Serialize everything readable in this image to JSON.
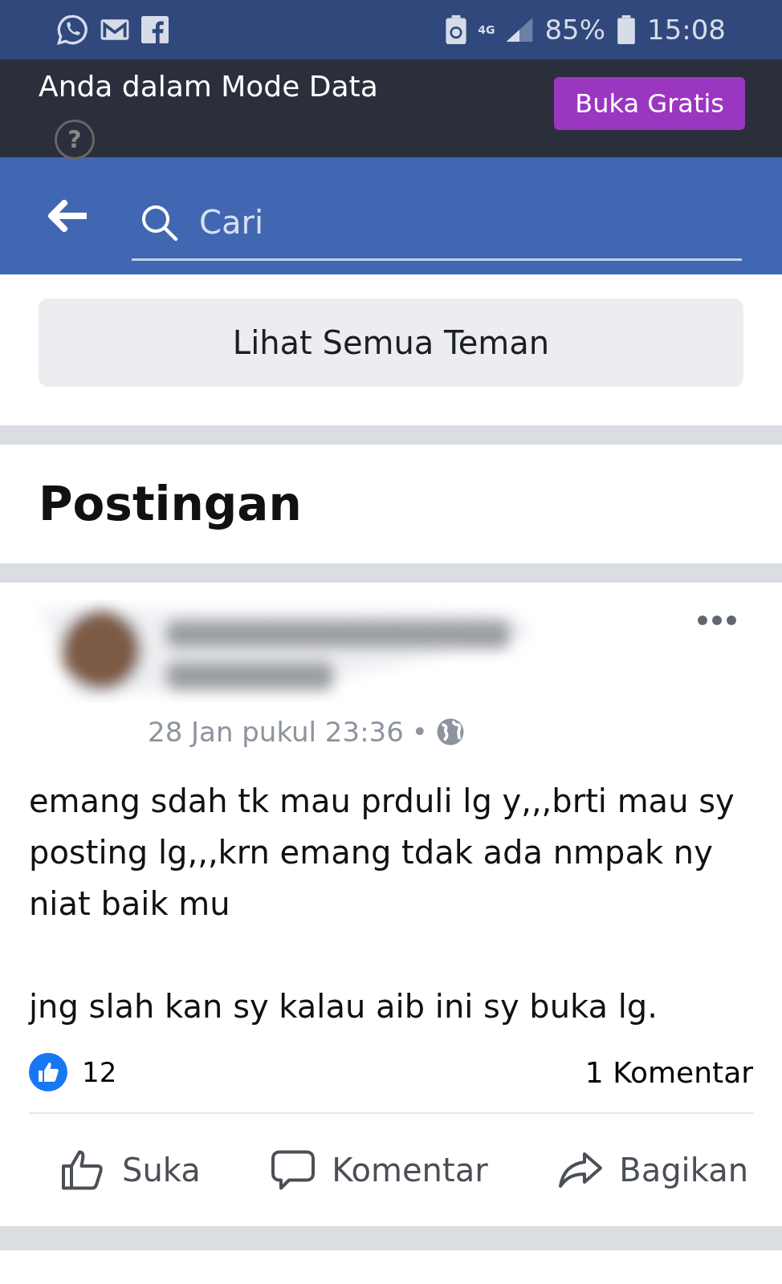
{
  "status_bar": {
    "battery": "85%",
    "time": "15:08",
    "network": "4G"
  },
  "data_mode_banner": {
    "message": "Anda dalam Mode Data",
    "help": "?",
    "button": "Buka Gratis"
  },
  "search": {
    "placeholder": "Cari"
  },
  "friends_button": "Lihat Semua Teman",
  "section_title": "Postingan",
  "post": {
    "timestamp": "28 Jan pukul 23:36",
    "separator": "•",
    "paragraphs": [
      "emang sdah tk mau prduli lg y,,,brti mau sy posting lg,,,krn emang tdak ada nmpak ny niat baik mu",
      "jng slah kan sy kalau aib ini sy buka lg."
    ],
    "likes": "12",
    "comments": "1 Komentar",
    "actions": [
      {
        "kind": "like",
        "label": "Suka"
      },
      {
        "kind": "comment",
        "label": "Komentar"
      },
      {
        "kind": "share",
        "label": "Bagikan"
      }
    ]
  }
}
